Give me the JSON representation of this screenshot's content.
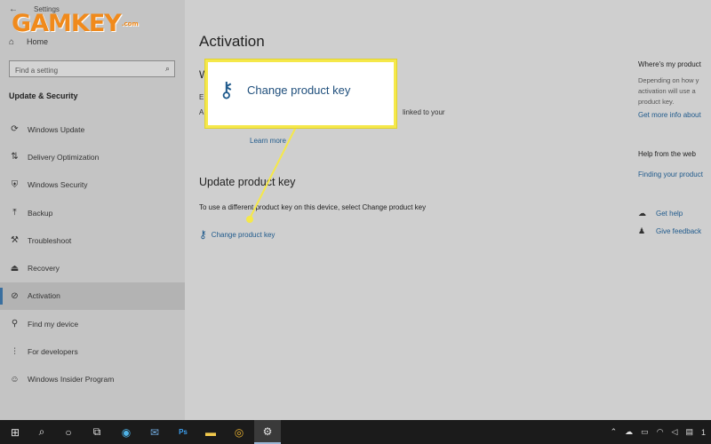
{
  "window": {
    "title": "Settings"
  },
  "brand": {
    "logo_text": "GAMKEY",
    "logo_suffix": ".com"
  },
  "sidebar": {
    "home_label": "Home",
    "search_placeholder": "Find a setting",
    "section_heading": "Update & Security",
    "items": [
      {
        "label": "Windows Update",
        "icon": "sync-icon"
      },
      {
        "label": "Delivery Optimization",
        "icon": "delivery-optimization-icon"
      },
      {
        "label": "Windows Security",
        "icon": "shield-icon"
      },
      {
        "label": "Backup",
        "icon": "backup-arrow-icon"
      },
      {
        "label": "Troubleshoot",
        "icon": "wrench-icon"
      },
      {
        "label": "Recovery",
        "icon": "recovery-icon"
      },
      {
        "label": "Activation",
        "icon": "check-circle-icon",
        "active": true
      },
      {
        "label": "Find my device",
        "icon": "person-pin-icon"
      },
      {
        "label": "For developers",
        "icon": "developer-sliders-icon"
      },
      {
        "label": "Windows Insider Program",
        "icon": "insider-smiley-icon"
      }
    ]
  },
  "main": {
    "title": "Activation",
    "partial_heading": "W",
    "partial_line1": "E",
    "partial_line2": "A",
    "partial_linked_text": "linked to your",
    "learn_more": "Learn more",
    "update_key_title": "Update product key",
    "update_key_desc": "To use a different product key on this device, select Change product key",
    "change_key_link": "Change product key"
  },
  "callout": {
    "label": "Change product key",
    "border_color": "#f5e84a"
  },
  "right_pane": {
    "where_heading": "Where's my product",
    "where_text_1": "Depending on how y",
    "where_text_2": "activation will use a",
    "where_text_3": "product key.",
    "where_link": "Get more info about",
    "help_heading": "Help from the web",
    "help_link": "Finding your product",
    "get_help": "Get help",
    "give_feedback": "Give feedback"
  },
  "taskbar": {
    "items": [
      "windows-start-icon",
      "search-icon",
      "cortana-circle-icon",
      "task-view-icon",
      "edge-icon",
      "mail-icon",
      "photoshop-icon",
      "file-explorer-icon",
      "chrome-icon",
      "settings-gear-icon"
    ],
    "photoshop_label": "Ps",
    "clock_partial": "1"
  },
  "colors": {
    "accent": "#1f5a8c",
    "logo": "#f08a1c",
    "highlight": "#f5e84a",
    "taskbar": "#1b1b1b"
  }
}
